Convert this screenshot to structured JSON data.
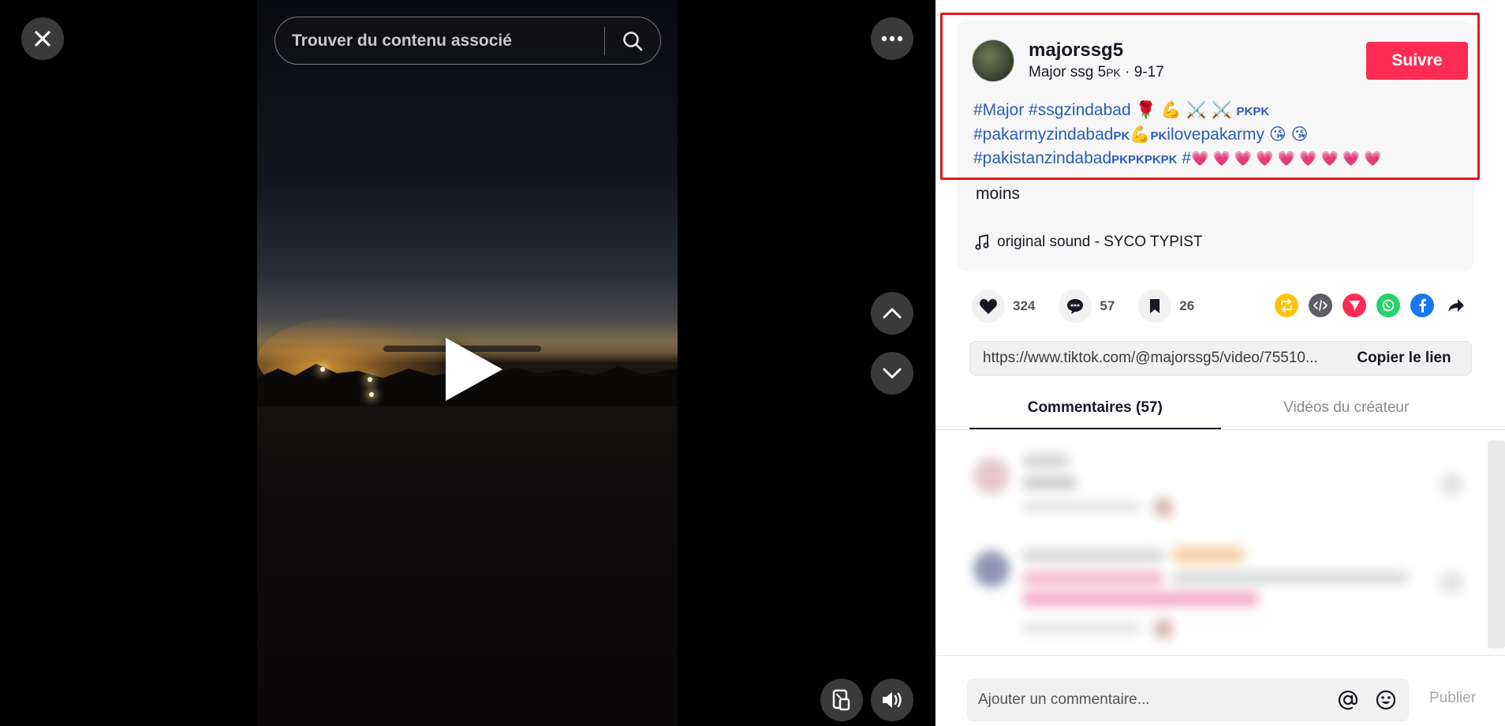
{
  "video": {
    "search_placeholder": "Trouver du contenu associé",
    "icons": [
      "close-icon",
      "search-icon",
      "more-icon",
      "chevron-up-icon",
      "chevron-down-icon",
      "play-icon",
      "picture-in-picture-icon",
      "volume-icon"
    ]
  },
  "post": {
    "username": "majorssg5",
    "display_name": "Major ssg 5",
    "flag": "PK",
    "date": "9-17",
    "follow_label": "Suivre",
    "hashtags_line1": [
      "#Major",
      "#ssgzindabad",
      "🌹",
      "💪",
      "⚔️",
      "⚔️",
      "PKPK"
    ],
    "hashtags_line2_a": "#pakarmyzindabad",
    "hashtags_line2_b": "PK",
    "hashtags_line2_c": "💪",
    "hashtags_line2_d": "PK",
    "hashtags_line2_e": "ilovepakarmy",
    "hashtags_line2_f": "😘 😘",
    "hashtags_line3_a": "#pakistanzindabad",
    "hashtags_line3_b": "PKPKPKPK",
    "hashtags_line3_c": "#",
    "hashtags_line3_d": "💗 💗 💗 💗 💗 💗 💗 💗 💗",
    "less_label": "moins",
    "sound": "original sound - SYCO TYPIST"
  },
  "actions": {
    "likes": "324",
    "comments": "57",
    "saves": "26"
  },
  "share": {
    "url": "https://www.tiktok.com/@majorssg5/video/75510...",
    "copy_label": "Copier le lien"
  },
  "tabs": {
    "comments": "Commentaires (57)",
    "creator_videos": "Vidéos du créateur"
  },
  "composer": {
    "placeholder": "Ajouter un commentaire...",
    "publish": "Publier"
  },
  "colors": {
    "accent": "#fe2c55",
    "hashtag": "#2b5db4",
    "highlight": "#e0191f"
  }
}
